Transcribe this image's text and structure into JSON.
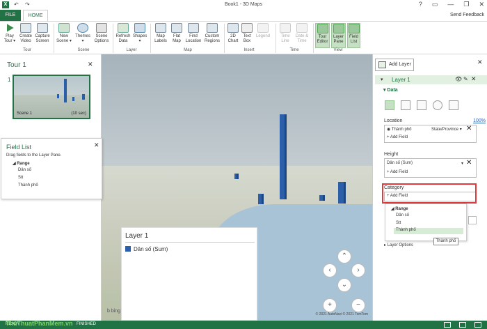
{
  "window": {
    "title": "Book1 - 3D Maps",
    "app_icon": "X",
    "undo_glyph": "↶",
    "redo_glyph": "↷",
    "minimize": "—",
    "restore": "❐",
    "close": "✕"
  },
  "tabs": {
    "file": "FILE",
    "home": "HOME",
    "send_feedback": "Send Feedback"
  },
  "ribbon": {
    "buttons": {
      "play_tour": "Play Tour ▾",
      "create_video": "Create Video",
      "capture_screen": "Capture Screen",
      "new_scene": "New Scene ▾",
      "themes": "Themes ▾",
      "scene_options": "Scene Options",
      "refresh_data": "Refresh Data",
      "shapes": "Shapes ▾",
      "map_labels": "Map Labels",
      "flat_map": "Flat Map",
      "find_location": "Find Location",
      "custom_regions": "Custom Regions",
      "chart_2d": "2D Chart",
      "text_box": "Text Box",
      "legend": "Legend",
      "time_line": "Time Line",
      "date_time": "Date & Time",
      "tour_editor": "Tour Editor",
      "layer_pane": "Layer Pane",
      "field_list": "Field List"
    },
    "groups": {
      "tour": "Tour",
      "scene": "Scene",
      "layer": "Layer",
      "map": "Map",
      "insert": "Insert",
      "time": "Time",
      "view": "View"
    }
  },
  "tour_pane": {
    "title": "Tour 1",
    "scene_number": "1",
    "scene_label": "Scene 1",
    "scene_duration": "(10 sec)"
  },
  "field_list": {
    "title": "Field List",
    "subtitle": "Drag fields to the Layer Pane.",
    "group": "Range",
    "fields": [
      "Dân số",
      "Stt",
      "Thành phố"
    ]
  },
  "map": {
    "legend_title": "Layer 1",
    "legend_item": "Dân số (Sum)",
    "bing": "b bing",
    "copyright": "© 2021 AutoNavi  © 2021 TomTom",
    "controls": {
      "up": "⌃",
      "left": "‹",
      "right": "›",
      "down": "⌄",
      "zoom_in": "+",
      "zoom_out": "−"
    }
  },
  "layer_pane": {
    "add_layer": "Add Layer",
    "layer_name": "Layer 1",
    "data_section": "Data",
    "location": {
      "label": "Location",
      "zoom_link": "100%",
      "field": "Thành phố",
      "type": "State/Province",
      "add_field": "Add Field"
    },
    "height": {
      "label": "Height",
      "field": "Dân số (Sum)",
      "add_field": "Add Field"
    },
    "category": {
      "label": "Category",
      "add_field": "Add Field"
    },
    "dropdown": {
      "group": "Range",
      "items": [
        "Dân số",
        "Stt",
        "Thành phố"
      ]
    },
    "tooltip": "Thành phố",
    "layer_options": "Layer Options"
  },
  "status": {
    "left": "READY",
    "mid": "FINISHED",
    "watermark": "ThuThuatPhanMem.vn"
  },
  "colors": {
    "accent": "#217346",
    "bar": "#2c5fa9",
    "highlight": "#e0393e"
  }
}
